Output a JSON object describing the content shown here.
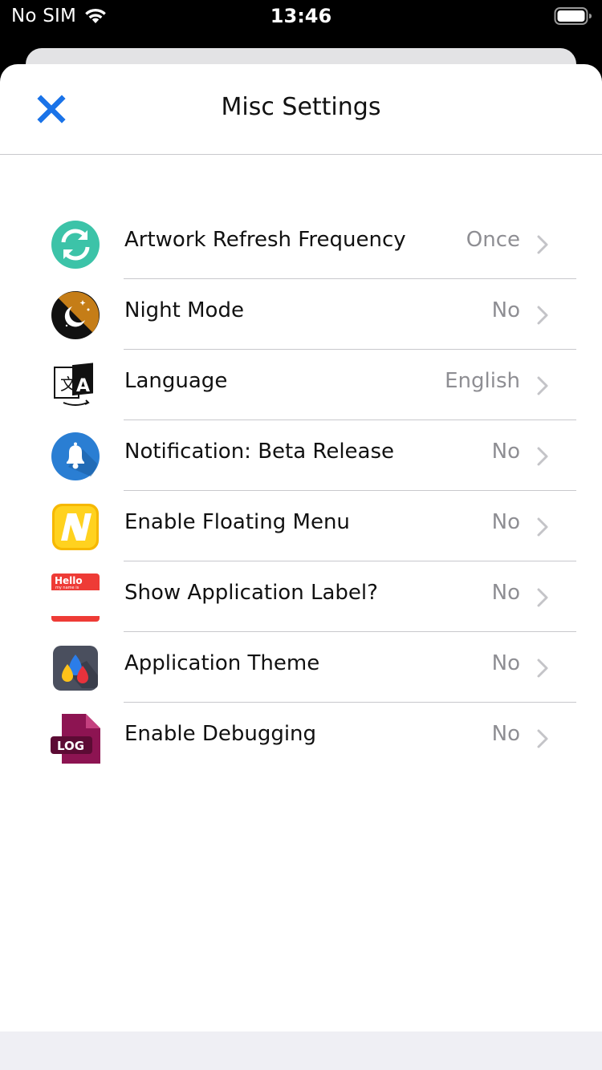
{
  "status_bar": {
    "carrier": "No SIM",
    "time": "13:46",
    "wifi_icon": "wifi-icon",
    "battery_icon": "battery-icon"
  },
  "header": {
    "title": "Misc Settings",
    "close_icon": "close-icon",
    "accent_color": "#1a73e8"
  },
  "settings": [
    {
      "icon": "refresh-icon",
      "label": "Artwork Refresh Frequency",
      "value": "Once"
    },
    {
      "icon": "night-mode-icon",
      "label": "Night Mode",
      "value": "No"
    },
    {
      "icon": "language-icon",
      "label": "Language",
      "value": "English"
    },
    {
      "icon": "bell-icon",
      "label": "Notification: Beta Release",
      "value": "No"
    },
    {
      "icon": "floating-menu-icon",
      "label": "Enable Floating Menu",
      "value": "No"
    },
    {
      "icon": "hello-label-icon",
      "label": "Show Application Label?",
      "value": "No"
    },
    {
      "icon": "theme-drops-icon",
      "label": "Application Theme",
      "value": "No"
    },
    {
      "icon": "log-file-icon",
      "label": "Enable Debugging",
      "value": "No"
    }
  ],
  "icon_text": {
    "hello": "Hello",
    "hello_sub": "my name is",
    "log": "LOG",
    "language_glyph_left": "文",
    "language_glyph_right": "A"
  }
}
